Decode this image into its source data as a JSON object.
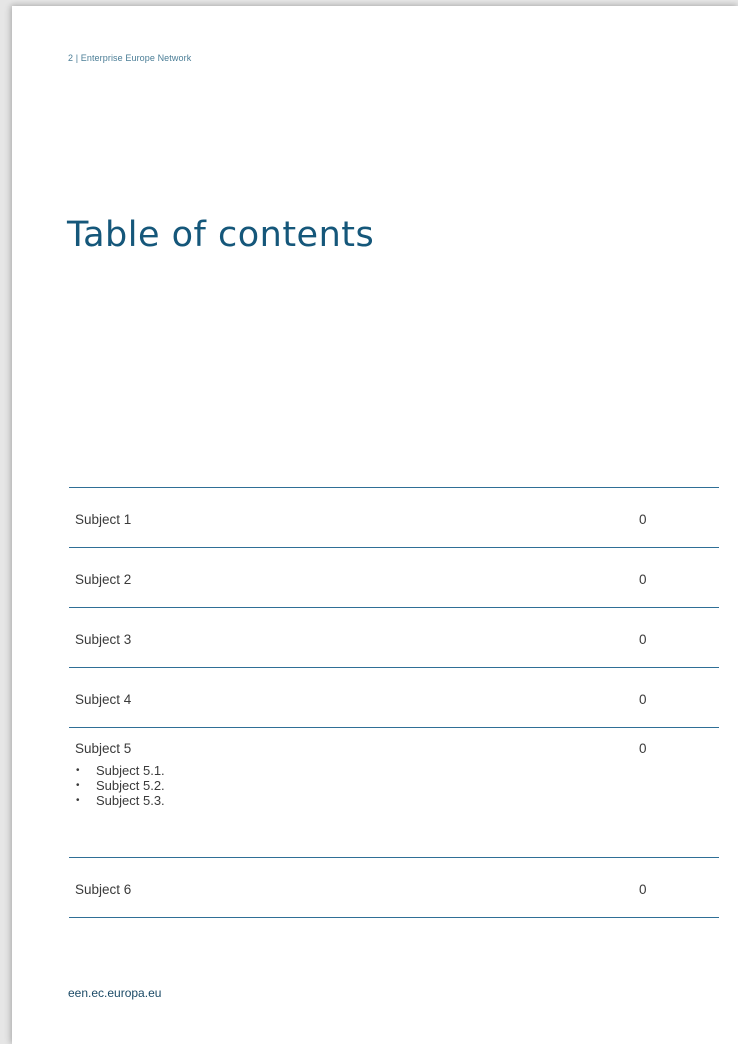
{
  "header": {
    "running_title": "2 | Enterprise Europe Network"
  },
  "title": "Table of contents",
  "toc": {
    "items": [
      {
        "label": "Subject 1",
        "page": "0"
      },
      {
        "label": "Subject 2",
        "page": "0"
      },
      {
        "label": "Subject 3",
        "page": "0"
      },
      {
        "label": "Subject 4",
        "page": "0"
      },
      {
        "label": "Subject 5",
        "page": "0",
        "subitems": [
          {
            "label": "Subject 5.1."
          },
          {
            "label": "Subject 5.2."
          },
          {
            "label": "Subject 5.3."
          }
        ]
      },
      {
        "label": "Subject 6",
        "page": "0"
      }
    ],
    "bullet": "•"
  },
  "footer": {
    "url": "een.ec.europa.eu"
  },
  "colors": {
    "title": "#15577a",
    "rule": "#2f6f96",
    "header_text": "#4a7d96",
    "footer_text": "#1b4a66"
  }
}
